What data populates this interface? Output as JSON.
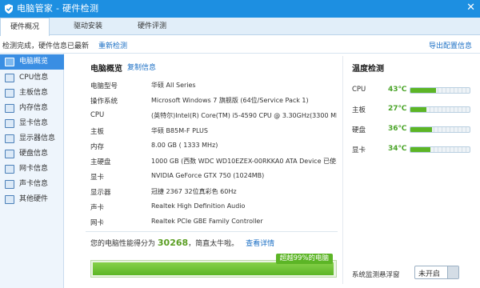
{
  "window": {
    "title": "电脑管家 - 硬件检测",
    "close_glyph": "✕"
  },
  "tabs": [
    {
      "label": "硬件概况",
      "active": true
    },
    {
      "label": "驱动安装",
      "active": false
    },
    {
      "label": "硬件评测",
      "active": false
    }
  ],
  "status": {
    "text": "检测完成，硬件信息已最新",
    "recheck": "重新检测",
    "export": "导出配置信息"
  },
  "sidebar": {
    "items": [
      {
        "label": "电脑概览",
        "icon": "monitor-icon",
        "active": true
      },
      {
        "label": "CPU信息",
        "icon": "cpu-icon",
        "active": false
      },
      {
        "label": "主板信息",
        "icon": "motherboard-icon",
        "active": false
      },
      {
        "label": "内存信息",
        "icon": "memory-icon",
        "active": false
      },
      {
        "label": "显卡信息",
        "icon": "graphics-card-icon",
        "active": false
      },
      {
        "label": "显示器信息",
        "icon": "display-icon",
        "active": false
      },
      {
        "label": "硬盘信息",
        "icon": "hard-disk-icon",
        "active": false
      },
      {
        "label": "网卡信息",
        "icon": "network-card-icon",
        "active": false
      },
      {
        "label": "声卡信息",
        "icon": "sound-card-icon",
        "active": false
      },
      {
        "label": "其他硬件",
        "icon": "other-hardware-icon",
        "active": false
      }
    ]
  },
  "overview": {
    "title": "电脑概览",
    "copy_link": "复制信息",
    "rows": [
      {
        "label": "电脑型号",
        "value": "华硕 All Series"
      },
      {
        "label": "操作系统",
        "value": "Microsoft Windows 7 旗舰版 (64位/Service Pack 1)"
      },
      {
        "label": "CPU",
        "value": "(英特尔)Intel(R) Core(TM) i5-4590 CPU @ 3.30GHz(3300 MHz)"
      },
      {
        "label": "主板",
        "value": "华硕 B85M-F PLUS"
      },
      {
        "label": "内存",
        "value": "8.00 GB ( 1333 MHz)"
      },
      {
        "label": "主硬盘",
        "value": "1000 GB (西数 WDC WD10EZEX-00RKKA0 ATA Device 已使..."
      },
      {
        "label": "显卡",
        "value": "NVIDIA GeForce GTX 750 (1024MB)"
      },
      {
        "label": "显示器",
        "value": "冠捷 2367 32位真彩色 60Hz"
      },
      {
        "label": "声卡",
        "value": "Realtek High Definition Audio"
      },
      {
        "label": "网卡",
        "value": "Realtek PCIe GBE Family Controller"
      }
    ],
    "score_prefix": "您的电脑性能得分为",
    "score": "30268",
    "score_suffix": "，简直太牛啦。",
    "score_detail": "查看详情",
    "beat_label": "超越99%的电脑",
    "beat_fraction": 0.99
  },
  "temperature": {
    "title": "温度检测",
    "items": [
      {
        "label": "CPU",
        "value": "43℃",
        "fraction": 0.43
      },
      {
        "label": "主板",
        "value": "27℃",
        "fraction": 0.27
      },
      {
        "label": "硬盘",
        "value": "36℃",
        "fraction": 0.36
      },
      {
        "label": "显卡",
        "value": "34℃",
        "fraction": 0.34
      }
    ],
    "float_label": "系统监测悬浮窗",
    "toggle_label": "未开启"
  },
  "colors": {
    "accent": "#1d8fe1",
    "good": "#5cb526",
    "link": "#1b6fc4"
  }
}
